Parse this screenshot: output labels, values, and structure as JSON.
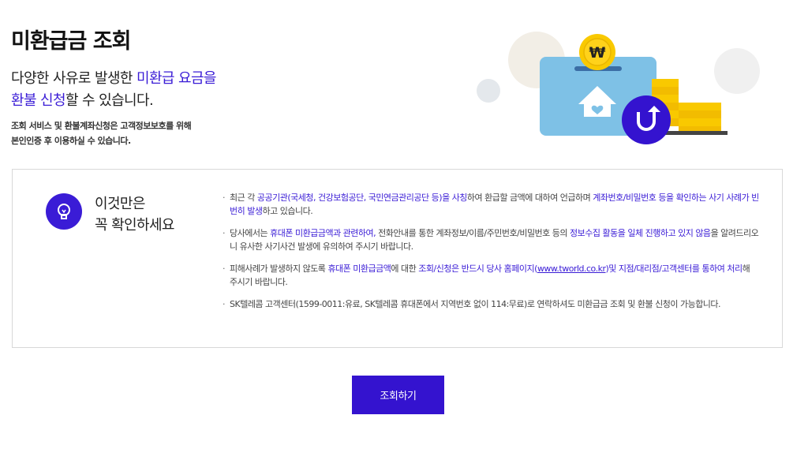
{
  "page": {
    "title": "미환급금 조회",
    "lead_line1_plain": "다양한 사유로 발생한 ",
    "lead_line1_accent": "미환급 요금을",
    "lead_line2_accent": "환불 신청",
    "lead_line2_plain": "할 수 있습니다.",
    "note_line1": "조회 서비스 및 환불계좌신청은 고객정보보호를 위해",
    "note_line2": "본인인증 후 이용하실 수 있습니다."
  },
  "hero": {
    "coin_symbol": "₩",
    "icons": [
      "piggy-bank-icon",
      "coin-icon",
      "house-heart-icon",
      "refund-arrow-icon",
      "coin-stack-icon"
    ]
  },
  "notice": {
    "heading_line1": "이것만은",
    "heading_line2": "꼭 확인하세요",
    "icon": "lightbulb-icon",
    "items": [
      {
        "p1": "최근 각 ",
        "a1": "공공기관(국세청, 건강보험공단, 국민연금관리공단 등)을 사칭",
        "p2": "하여 환급할 금액에 대하여 언급하며 ",
        "a2": "계좌번호/비밀번호 등을 확인하는 사기 사례가 빈번히 발생",
        "p3": "하고 있습니다."
      },
      {
        "p1": "당사에서는 ",
        "a1": "휴대폰 미환급금액과 관련하여,",
        "p2": " 전화안내를 통한 계좌정보/이름/주민번호/비밀번호 등의 ",
        "a2": "정보수집 활동을 일체 진행하고 있지 않음",
        "p3": "을 알려드리오니 유사한 사기사건 발생에 유의하여 주시기 바랍니다."
      },
      {
        "p1": "피해사례가 발생하지 않도록 ",
        "a1": "휴대폰 미환급금액",
        "p2": "에 대한 ",
        "a2": "조회/신청은 반드시 당사 홈페이지(",
        "link": "www.tworld.co.kr",
        "a3": ")및 지점/대리점/고객센터를 통하여 처리",
        "p3": "해 주시기 바랍니다."
      },
      {
        "p1": "SK텔레콤 고객센터(1599-0011:유료, SK텔레콤 휴대폰에서 지역번호 없이 114:무료)로 연락하셔도 미환급금 조회 및 환불 신청이 가능합니다."
      }
    ]
  },
  "actions": {
    "inquiry_button": "조회하기"
  },
  "colors": {
    "accent": "#3a1cd6",
    "button": "#3413cf",
    "card": "#7ec1e6",
    "coin": "#f9c900"
  }
}
